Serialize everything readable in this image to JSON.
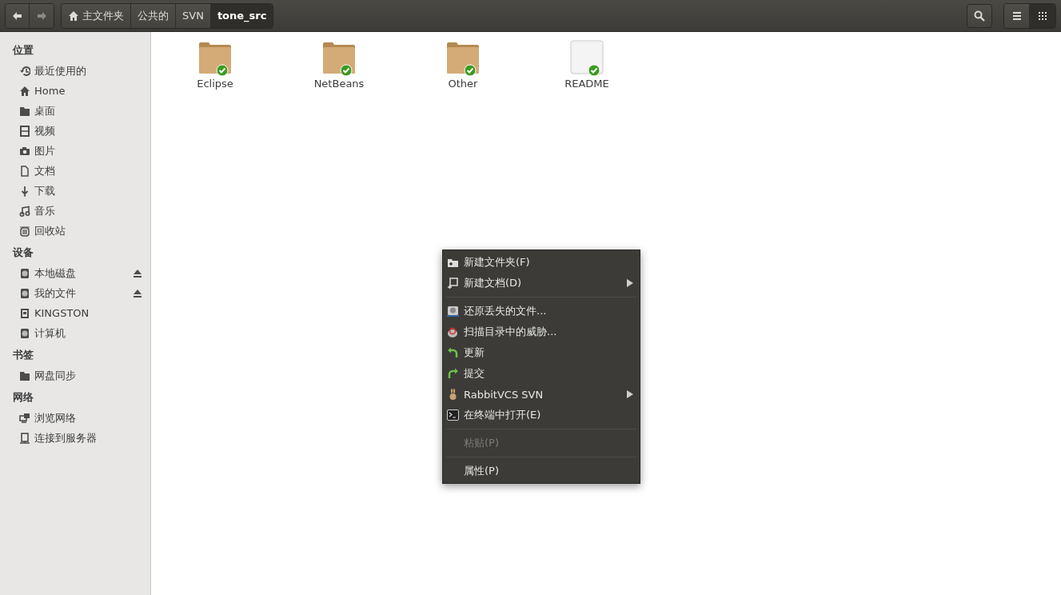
{
  "toolbar": {
    "nav": [
      {
        "kind": "back",
        "disabled": false
      },
      {
        "kind": "forward",
        "disabled": true
      }
    ],
    "path": [
      {
        "label": "主文件夹",
        "kind": "home",
        "selected": false
      },
      {
        "label": "公共的",
        "kind": "plain",
        "selected": false
      },
      {
        "label": "SVN",
        "kind": "plain",
        "selected": false
      },
      {
        "label": "tone_src",
        "kind": "plain",
        "selected": true
      }
    ],
    "views": [
      {
        "kind": "list",
        "selected": false
      },
      {
        "kind": "grid",
        "selected": true
      }
    ]
  },
  "sidebar": {
    "sections": [
      {
        "title": "位置",
        "items": [
          {
            "label": "最近使用的",
            "kind": "recent"
          },
          {
            "label": "Home",
            "kind": "home"
          },
          {
            "label": "桌面",
            "kind": "folder"
          },
          {
            "label": "视频",
            "kind": "video"
          },
          {
            "label": "图片",
            "kind": "camera"
          },
          {
            "label": "文档",
            "kind": "document"
          },
          {
            "label": "下载",
            "kind": "download"
          },
          {
            "label": "音乐",
            "kind": "music"
          },
          {
            "label": "回收站",
            "kind": "trash"
          }
        ]
      },
      {
        "title": "设备",
        "items": [
          {
            "label": "本地磁盘",
            "kind": "disk",
            "ejectable": true
          },
          {
            "label": "我的文件",
            "kind": "disk",
            "ejectable": true
          },
          {
            "label": "KINGSTON",
            "kind": "usb",
            "ejectable": false
          },
          {
            "label": "计算机",
            "kind": "disk",
            "ejectable": false
          }
        ]
      },
      {
        "title": "书签",
        "items": [
          {
            "label": "网盘同步",
            "kind": "folder"
          }
        ]
      },
      {
        "title": "网络",
        "items": [
          {
            "label": "浏览网络",
            "kind": "network"
          },
          {
            "label": "连接到服务器",
            "kind": "server"
          }
        ]
      }
    ]
  },
  "files": [
    {
      "name": "Eclipse",
      "kind": "folder",
      "synced": true
    },
    {
      "name": "NetBeans",
      "kind": "folder",
      "synced": true
    },
    {
      "name": "Other",
      "kind": "folder",
      "synced": true
    },
    {
      "name": "README",
      "kind": "file",
      "synced": true
    }
  ],
  "context_menu": [
    {
      "kind": "item",
      "label": "新建文件夹(F)",
      "submenu": false,
      "disabled": false
    },
    {
      "kind": "item",
      "label": "新建文档(D)",
      "submenu": true,
      "disabled": false
    },
    {
      "kind": "separator"
    },
    {
      "kind": "item",
      "label": "还原丢失的文件...",
      "submenu": false,
      "disabled": false
    },
    {
      "kind": "item",
      "label": "扫描目录中的威胁...",
      "submenu": false,
      "disabled": false
    },
    {
      "kind": "item",
      "label": "更新",
      "submenu": false,
      "disabled": false
    },
    {
      "kind": "item",
      "label": "提交",
      "submenu": false,
      "disabled": false
    },
    {
      "kind": "item",
      "label": "RabbitVCS SVN",
      "submenu": true,
      "disabled": false
    },
    {
      "kind": "item",
      "label": "在终端中打开(E)",
      "submenu": false,
      "disabled": false
    },
    {
      "kind": "separator"
    },
    {
      "kind": "item",
      "label": "粘贴(P)",
      "submenu": false,
      "disabled": true
    },
    {
      "kind": "separator"
    },
    {
      "kind": "item",
      "label": "属性(P)",
      "submenu": false,
      "disabled": false
    }
  ]
}
